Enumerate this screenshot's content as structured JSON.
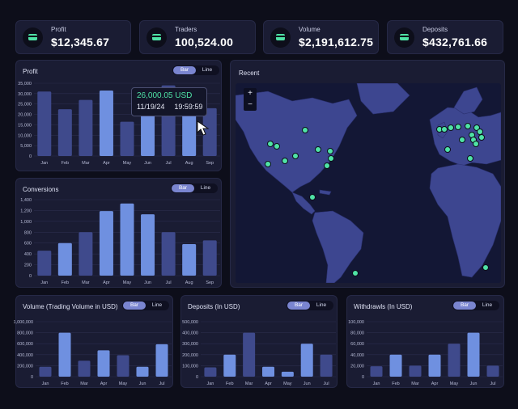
{
  "colors": {
    "bar_light": "#6f90e0",
    "bar_dark": "#3f4a8c",
    "accent": "#4fe3a6",
    "land": "#3d4690",
    "ocean": "#131735"
  },
  "stats": [
    {
      "label": "Profit",
      "value": "$12,345.67",
      "icon": "card-icon"
    },
    {
      "label": "Traders",
      "value": "100,524.00",
      "icon": "card-icon"
    },
    {
      "label": "Volume",
      "value": "$2,191,612.75",
      "icon": "card-icon"
    },
    {
      "label": "Deposits",
      "value": "$432,761.66",
      "icon": "card-icon"
    }
  ],
  "toggle": {
    "bar": "Bar",
    "line": "Line"
  },
  "profit": {
    "title": "Profit",
    "tooltip": {
      "value": "26,000.05 USD",
      "date": "11/19/24",
      "time": "19:59:59"
    }
  },
  "conversions": {
    "title": "Conversions"
  },
  "volume": {
    "title": "Volume (Trading Volume in USD)"
  },
  "deposits": {
    "title": "Deposits (In USD)"
  },
  "withdrawls": {
    "title": "Withdrawls (In USD)"
  },
  "recent": {
    "title": "Recent",
    "zoom_in": "+",
    "zoom_out": "−"
  },
  "chart_data": [
    {
      "id": "profit",
      "type": "bar",
      "categories": [
        "Jan",
        "Feb",
        "Mar",
        "Apr",
        "May",
        "Jun",
        "Jul",
        "Aug",
        "Sep"
      ],
      "values": [
        31000,
        22500,
        27000,
        31500,
        16500,
        30500,
        34000,
        26000,
        23000
      ],
      "highlight": [
        false,
        false,
        false,
        true,
        false,
        true,
        false,
        true,
        false
      ],
      "yticks": [
        "0",
        "5,000",
        "10,000",
        "15,000",
        "20,000",
        "25,000",
        "30,000",
        "35,000"
      ],
      "ylim": [
        0,
        35000
      ]
    },
    {
      "id": "conversions",
      "type": "bar",
      "categories": [
        "Jan",
        "Feb",
        "Mar",
        "Apr",
        "May",
        "Jun",
        "Jul",
        "Aug",
        "Sep"
      ],
      "values": [
        460,
        600,
        800,
        1190,
        1330,
        1130,
        800,
        580,
        650
      ],
      "highlight": [
        false,
        true,
        false,
        true,
        true,
        true,
        false,
        true,
        false
      ],
      "yticks": [
        "0",
        "200",
        "400",
        "600",
        "800",
        "1,000",
        "1,200",
        "1,400"
      ],
      "ylim": [
        0,
        1400
      ]
    },
    {
      "id": "volume",
      "type": "bar",
      "categories": [
        "Jan",
        "Feb",
        "Mar",
        "Apr",
        "May",
        "Jun",
        "Jul"
      ],
      "values": [
        180000,
        800000,
        290000,
        480000,
        390000,
        180000,
        590000
      ],
      "highlight": [
        false,
        true,
        false,
        true,
        false,
        true,
        true
      ],
      "yticks": [
        "0",
        "200,000",
        "400,000",
        "600,000",
        "800,000",
        "1,000,000"
      ],
      "ylim": [
        0,
        1000000
      ]
    },
    {
      "id": "deposits",
      "type": "bar",
      "categories": [
        "Jan",
        "Feb",
        "Mar",
        "Apr",
        "May",
        "Jun",
        "Jul"
      ],
      "values": [
        85000,
        200000,
        400000,
        90000,
        45000,
        300000,
        200000
      ],
      "highlight": [
        false,
        true,
        false,
        true,
        true,
        true,
        false
      ],
      "yticks": [
        "0",
        "100,000",
        "200,000",
        "300,000",
        "400,000",
        "500,000"
      ],
      "ylim": [
        0,
        500000
      ]
    },
    {
      "id": "withdrawls",
      "type": "bar",
      "categories": [
        "Jan",
        "Feb",
        "Mar",
        "Apr",
        "May",
        "Jun",
        "Jul"
      ],
      "values": [
        19000,
        40000,
        20000,
        40000,
        60000,
        80000,
        20000
      ],
      "highlight": [
        false,
        true,
        false,
        true,
        false,
        true,
        false
      ],
      "yticks": [
        "0",
        "20,000",
        "40,000",
        "60,000",
        "80,000",
        "100,000"
      ],
      "ylim": [
        0,
        100000
      ]
    }
  ]
}
